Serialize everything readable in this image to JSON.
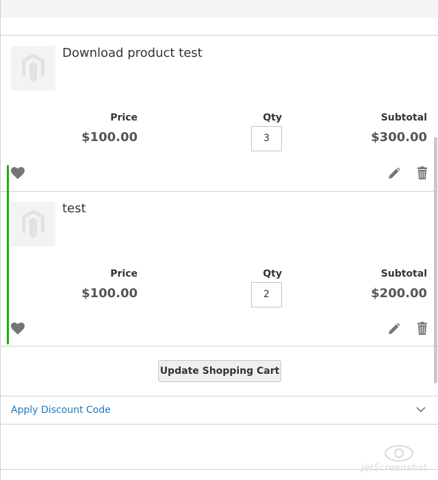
{
  "cart": {
    "items": [
      {
        "name": "Download product test",
        "price_label": "Price",
        "price": "$100.00",
        "qty_label": "Qty",
        "qty": "3",
        "subtotal_label": "Subtotal",
        "subtotal": "$300.00"
      },
      {
        "name": "test",
        "price_label": "Price",
        "price": "$100.00",
        "qty_label": "Qty",
        "qty": "2",
        "subtotal_label": "Subtotal",
        "subtotal": "$200.00"
      }
    ],
    "update_label": "Update Shopping Cart",
    "discount_label": "Apply Discount Code"
  },
  "watermark": {
    "text": "jetScreenshot"
  },
  "icons": {
    "wishlist": "heart-icon",
    "edit": "pencil-icon",
    "delete": "trash-icon",
    "placeholder": "magento-logo-icon",
    "expand": "chevron-down-icon"
  },
  "colors": {
    "link": "#1979c3",
    "marker": "#12b300",
    "icon": "#757575"
  }
}
